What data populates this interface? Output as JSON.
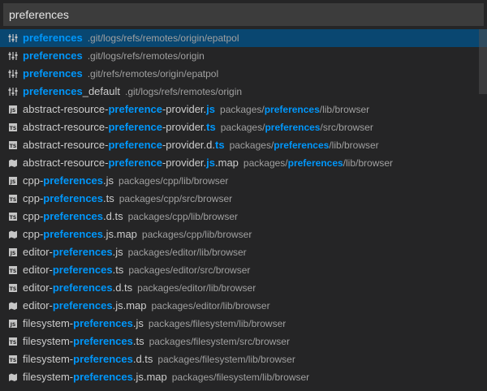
{
  "search": {
    "value": "preferences"
  },
  "results": [
    {
      "icon": "settings-icon",
      "label": [
        [
          "preferences",
          true
        ]
      ],
      "path": [
        [
          ".git/logs/refs/remotes/origin/epatpol",
          false
        ]
      ],
      "selected": true
    },
    {
      "icon": "settings-icon",
      "label": [
        [
          "preferences",
          true
        ]
      ],
      "path": [
        [
          ".git/logs/refs/remotes/origin",
          false
        ]
      ]
    },
    {
      "icon": "settings-icon",
      "label": [
        [
          "preferences",
          true
        ]
      ],
      "path": [
        [
          ".git/refs/remotes/origin/epatpol",
          false
        ]
      ]
    },
    {
      "icon": "settings-icon",
      "label": [
        [
          "preferences",
          true
        ],
        [
          "_default",
          false
        ]
      ],
      "path": [
        [
          ".git/logs/refs/remotes/origin",
          false
        ]
      ]
    },
    {
      "icon": "js-file-icon",
      "label": [
        [
          "abstract-resource-",
          false
        ],
        [
          "preference",
          true
        ],
        [
          "-provider.",
          false
        ],
        [
          "js",
          true
        ]
      ],
      "path": [
        [
          "packages/",
          false
        ],
        [
          "preferences",
          true
        ],
        [
          "/lib/browser",
          false
        ]
      ]
    },
    {
      "icon": "ts-file-icon",
      "label": [
        [
          "abstract-resource-",
          false
        ],
        [
          "preference",
          true
        ],
        [
          "-provider.",
          false
        ],
        [
          "ts",
          true
        ]
      ],
      "path": [
        [
          "packages/",
          false
        ],
        [
          "preferences",
          true
        ],
        [
          "/src/browser",
          false
        ]
      ]
    },
    {
      "icon": "ts-file-icon",
      "label": [
        [
          "abstract-resource-",
          false
        ],
        [
          "preference",
          true
        ],
        [
          "-provider.d.",
          false
        ],
        [
          "ts",
          true
        ]
      ],
      "path": [
        [
          "packages/",
          false
        ],
        [
          "preferences",
          true
        ],
        [
          "/lib/browser",
          false
        ]
      ]
    },
    {
      "icon": "map-file-icon",
      "label": [
        [
          "abstract-resource-",
          false
        ],
        [
          "preference",
          true
        ],
        [
          "-provider.",
          false
        ],
        [
          "js",
          true
        ],
        [
          ".map",
          false
        ]
      ],
      "path": [
        [
          "packages/",
          false
        ],
        [
          "preferences",
          true
        ],
        [
          "/lib/browser",
          false
        ]
      ]
    },
    {
      "icon": "js-file-icon",
      "label": [
        [
          "cpp-",
          false
        ],
        [
          "preferences",
          true
        ],
        [
          ".js",
          false
        ]
      ],
      "path": [
        [
          "packages/cpp/lib/browser",
          false
        ]
      ]
    },
    {
      "icon": "ts-file-icon",
      "label": [
        [
          "cpp-",
          false
        ],
        [
          "preferences",
          true
        ],
        [
          ".ts",
          false
        ]
      ],
      "path": [
        [
          "packages/cpp/src/browser",
          false
        ]
      ]
    },
    {
      "icon": "ts-file-icon",
      "label": [
        [
          "cpp-",
          false
        ],
        [
          "preferences",
          true
        ],
        [
          ".d.ts",
          false
        ]
      ],
      "path": [
        [
          "packages/cpp/lib/browser",
          false
        ]
      ]
    },
    {
      "icon": "map-file-icon",
      "label": [
        [
          "cpp-",
          false
        ],
        [
          "preferences",
          true
        ],
        [
          ".js.map",
          false
        ]
      ],
      "path": [
        [
          "packages/cpp/lib/browser",
          false
        ]
      ]
    },
    {
      "icon": "js-file-icon",
      "label": [
        [
          "editor-",
          false
        ],
        [
          "preferences",
          true
        ],
        [
          ".js",
          false
        ]
      ],
      "path": [
        [
          "packages/editor/lib/browser",
          false
        ]
      ]
    },
    {
      "icon": "ts-file-icon",
      "label": [
        [
          "editor-",
          false
        ],
        [
          "preferences",
          true
        ],
        [
          ".ts",
          false
        ]
      ],
      "path": [
        [
          "packages/editor/src/browser",
          false
        ]
      ]
    },
    {
      "icon": "ts-file-icon",
      "label": [
        [
          "editor-",
          false
        ],
        [
          "preferences",
          true
        ],
        [
          ".d.ts",
          false
        ]
      ],
      "path": [
        [
          "packages/editor/lib/browser",
          false
        ]
      ]
    },
    {
      "icon": "map-file-icon",
      "label": [
        [
          "editor-",
          false
        ],
        [
          "preferences",
          true
        ],
        [
          ".js.map",
          false
        ]
      ],
      "path": [
        [
          "packages/editor/lib/browser",
          false
        ]
      ]
    },
    {
      "icon": "js-file-icon",
      "label": [
        [
          "filesystem-",
          false
        ],
        [
          "preferences",
          true
        ],
        [
          ".js",
          false
        ]
      ],
      "path": [
        [
          "packages/filesystem/lib/browser",
          false
        ]
      ]
    },
    {
      "icon": "ts-file-icon",
      "label": [
        [
          "filesystem-",
          false
        ],
        [
          "preferences",
          true
        ],
        [
          ".ts",
          false
        ]
      ],
      "path": [
        [
          "packages/filesystem/src/browser",
          false
        ]
      ]
    },
    {
      "icon": "ts-file-icon",
      "label": [
        [
          "filesystem-",
          false
        ],
        [
          "preferences",
          true
        ],
        [
          ".d.ts",
          false
        ]
      ],
      "path": [
        [
          "packages/filesystem/lib/browser",
          false
        ]
      ]
    },
    {
      "icon": "map-file-icon",
      "label": [
        [
          "filesystem-",
          false
        ],
        [
          "preferences",
          true
        ],
        [
          ".js.map",
          false
        ]
      ],
      "path": [
        [
          "packages/filesystem/lib/browser",
          false
        ]
      ]
    }
  ],
  "colors": {
    "background": "#252526",
    "input_bg": "#3c3c3c",
    "selected_bg": "#094771",
    "highlight": "#0097fb",
    "path_text": "#a0a0a0",
    "label_text": "#cccccc"
  }
}
